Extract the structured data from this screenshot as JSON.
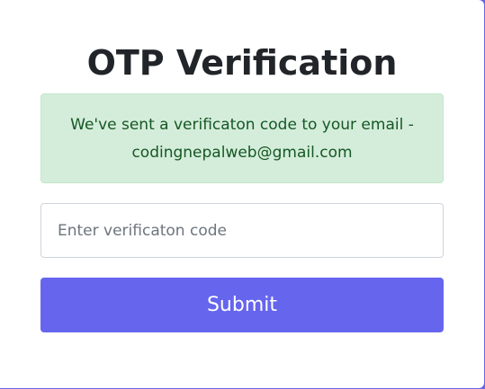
{
  "form": {
    "title": "OTP Verification",
    "alert_message": "We've sent a verificaton code to your email - codingnepalweb@gmail.com",
    "otp_input": {
      "placeholder": "Enter verificaton code",
      "value": ""
    },
    "submit_label": "Submit"
  },
  "colors": {
    "accent": "#6665ee",
    "alert_background": "#d4edda",
    "alert_text": "#155724"
  }
}
